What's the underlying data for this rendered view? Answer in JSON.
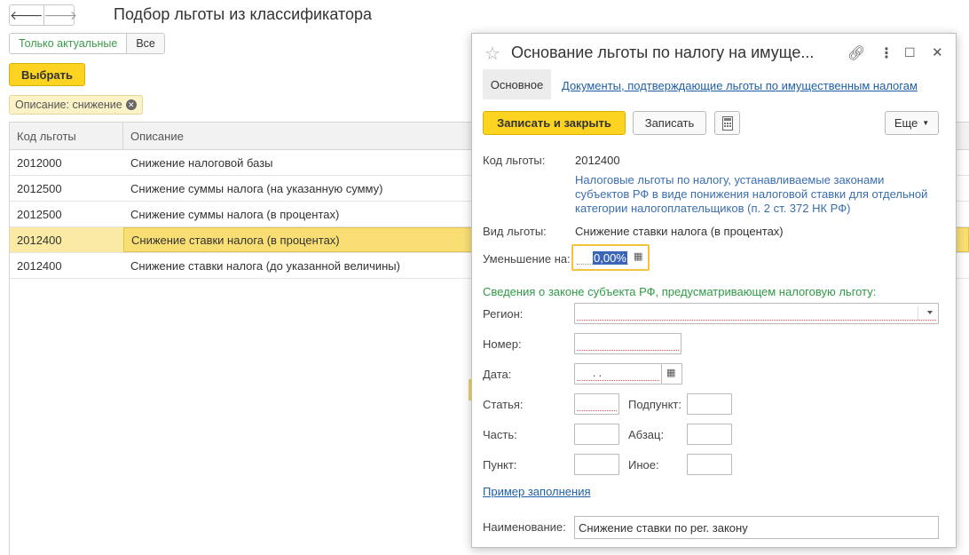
{
  "main": {
    "title": "Подбор льготы из классификатора",
    "nav": {
      "back": "🡐",
      "forward": "🡒"
    },
    "filter_toggle": {
      "actual": "Только актуальные",
      "all": "Все"
    },
    "select_button": "Выбрать",
    "filter_tag": "Описание: снижение",
    "columns": [
      "Код льготы",
      "Описание"
    ],
    "rows": [
      {
        "code": "2012000",
        "desc": "Снижение налоговой базы"
      },
      {
        "code": "2012500",
        "desc": "Снижение суммы налога (на указанную сумму)"
      },
      {
        "code": "2012500",
        "desc": "Снижение суммы налога (в процентах)"
      },
      {
        "code": "2012400",
        "desc": "Снижение ставки налога (в процентах)"
      },
      {
        "code": "2012400",
        "desc": "Снижение ставки налога (до указанной величины)"
      }
    ],
    "selected_row": 3
  },
  "dialog": {
    "title": "Основание льготы по налогу на имуще...",
    "tabs": {
      "main": "Основное",
      "docs": "Документы, подтверждающие льготы по имущественным налогам"
    },
    "buttons": {
      "save_close": "Записать и закрыть",
      "save": "Записать",
      "more": "Еще"
    },
    "code_label": "Код льготы:",
    "code_value": "2012400",
    "code_description": "Налоговые льготы по налогу, устанавливаемые законами субъектов РФ в виде понижения налоговой ставки для отдельной категории налогоплательщиков (п. 2 ст. 372 НК РФ)",
    "kind_label": "Вид льготы:",
    "kind_value": "Снижение ставки налога (в процентах)",
    "reduction_label": "Уменьшение на:",
    "reduction_value": "0,00%",
    "law_section": "Сведения о законе субъекта РФ, предусматривающем налоговую льготу:",
    "fields": {
      "region": "Регион:",
      "number": "Номер:",
      "date": "Дата:",
      "date_value": " .  .",
      "article": "Статья:",
      "subclause": "Подпункт:",
      "part": "Часть:",
      "paragraph": "Абзац:",
      "clause": "Пункт:",
      "other": "Иное:"
    },
    "example_link": "Пример заполнения",
    "name_label": "Наименование:",
    "name_value": "Снижение ставки по рег. закону"
  },
  "colors": {
    "accent_yellow": "#fbd320",
    "link_blue": "#1f5fa8",
    "green": "#2e9a47",
    "selection": "#f9df73"
  }
}
